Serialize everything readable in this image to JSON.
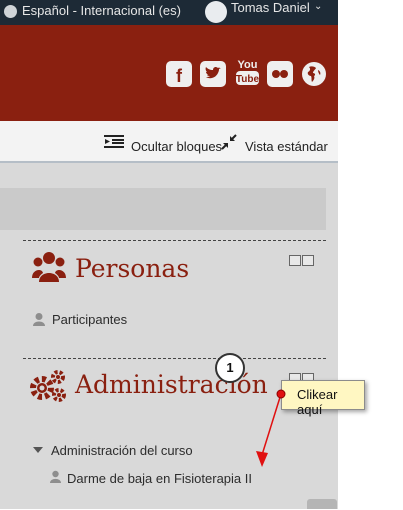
{
  "topbar": {
    "language": "Español - Internacional (es)",
    "user_name": "Tomas Daniel",
    "caret": "⌄"
  },
  "header": {
    "social_icons": [
      "facebook-icon",
      "twitter-icon",
      "youtube-icon",
      "flickr-icon",
      "globe-icon"
    ],
    "youtube_label": "You Tube"
  },
  "toolbar": {
    "hide_blocks": "Ocultar bloques",
    "standard_view": "Vista estándar"
  },
  "blocks": {
    "personas": {
      "title": "Personas",
      "items": [
        "Participantes"
      ]
    },
    "admin": {
      "title": "Administración",
      "section": "Administración del curso",
      "items": [
        "Darme de baja en Fisioterapia II"
      ]
    }
  },
  "annotation": {
    "step": "1",
    "note": "Clikear aquí"
  },
  "colors": {
    "brand": "#8a2010",
    "topbar": "#1d2a36",
    "note_bg": "#fff7c2",
    "arrow": "#e01010"
  }
}
